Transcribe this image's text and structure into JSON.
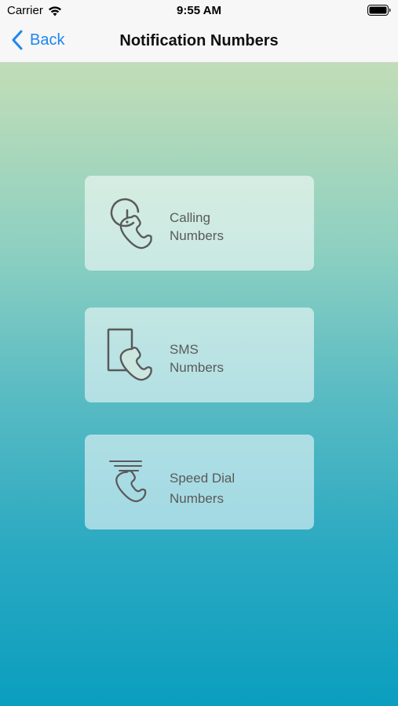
{
  "status_bar": {
    "carrier": "Carrier",
    "time": "9:55 AM",
    "icons": [
      "wifi-icon",
      "battery-icon"
    ]
  },
  "nav": {
    "back_label": "Back",
    "title": "Notification Numbers",
    "accent_color": "#1e86f1"
  },
  "menu": {
    "items": [
      {
        "line1": "Calling",
        "line2": "Numbers",
        "icon": "phone-alert-icon"
      },
      {
        "line1": "SMS",
        "line2": "Numbers",
        "icon": "phone-sms-icon"
      },
      {
        "line1": "Speed Dial",
        "line2": "Numbers",
        "icon": "phone-speed-dial-icon"
      }
    ]
  }
}
